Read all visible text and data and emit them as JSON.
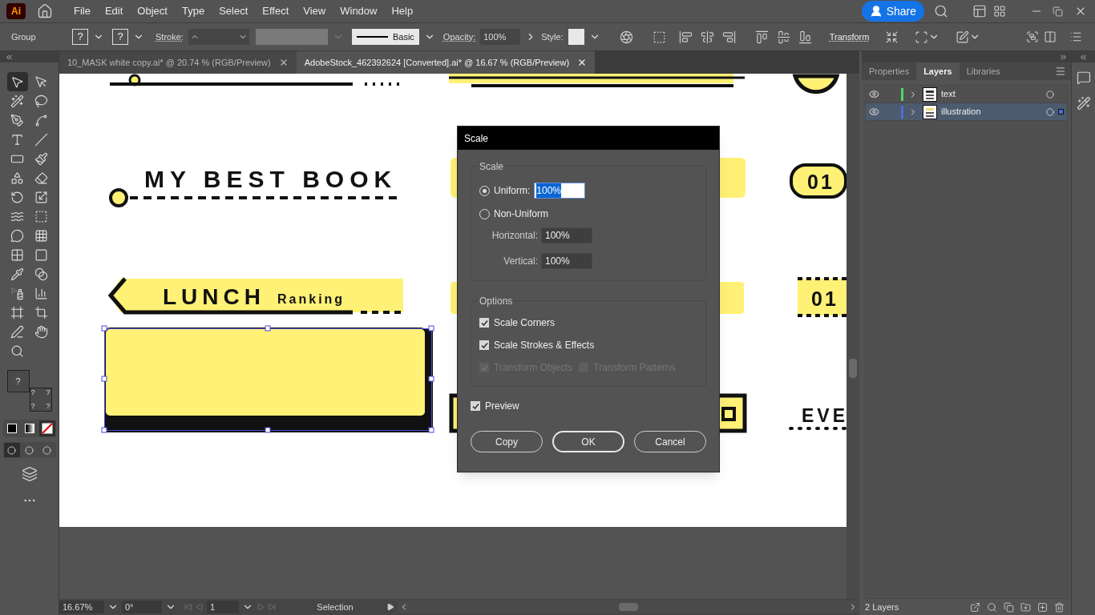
{
  "app_logo": "Ai",
  "menu": [
    "File",
    "Edit",
    "Object",
    "Type",
    "Select",
    "Effect",
    "View",
    "Window",
    "Help"
  ],
  "share_button": "Share",
  "control_bar": {
    "selection": "Group",
    "fill_label": "?",
    "stroke_swatch_label": "?",
    "stroke_label": "Stroke:",
    "brush": "Basic",
    "opacity_label": "Opacity:",
    "opacity": "100%",
    "style_label": "Style:",
    "transform": "Transform"
  },
  "tabs": [
    {
      "label": "10_MASK white copy.ai* @ 20.74 % (RGB/Preview)",
      "selected": false
    },
    {
      "label": "AdobeStock_462392624 [Converted].ai* @ 16.67 % (RGB/Preview)",
      "selected": true
    }
  ],
  "toolbar": {
    "tools": [
      {
        "selected": true
      },
      {
        "selected": false
      },
      {
        "selected": false
      },
      {
        "selected": false
      },
      {
        "selected": false
      },
      {
        "selected": false
      },
      {
        "selected": false
      },
      {
        "selected": false
      },
      {
        "selected": false
      },
      {
        "selected": false
      },
      {
        "selected": false
      },
      {
        "selected": false
      },
      {
        "selected": false
      },
      {
        "selected": false
      },
      {
        "selected": false
      },
      {
        "selected": false
      },
      {
        "selected": false
      },
      {
        "selected": false
      },
      {
        "selected": false
      },
      {
        "selected": false
      },
      {
        "selected": false
      },
      {
        "selected": false
      },
      {
        "selected": false
      },
      {
        "selected": false
      },
      {
        "selected": false
      },
      {
        "selected": false
      },
      {
        "selected": false
      },
      {
        "selected": false
      },
      {
        "selected": false
      }
    ],
    "fill_label": "?",
    "stroke_labels": [
      "?",
      "?",
      "?",
      "?"
    ],
    "color_modes": [
      {
        "selected": false
      },
      {
        "selected": false
      },
      {
        "selected": true
      }
    ],
    "draw_modes": [
      {
        "selected": true
      },
      {
        "selected": false
      },
      {
        "selected": false
      }
    ]
  },
  "artwork": {
    "heading": "MY BEST BOOK",
    "banner_title": "LUNCH",
    "banner_subtitle": "Ranking",
    "badges": [
      "01",
      "01"
    ],
    "partial_heading": "EVE"
  },
  "dialog": {
    "title": "Scale",
    "scale_section": "Scale",
    "uniform": {
      "label": "Uniform:",
      "selected": true,
      "value": "100%",
      "text_selected": true
    },
    "non_uniform": {
      "label": "Non-Uniform",
      "selected": false
    },
    "horizontal": {
      "label": "Horizontal:",
      "value": "100%"
    },
    "vertical": {
      "label": "Vertical:",
      "value": "100%"
    },
    "options_section": "Options",
    "options": [
      {
        "label": "Scale Corners",
        "checked": true,
        "disabled": false
      },
      {
        "label": "Scale Strokes & Effects",
        "checked": true,
        "disabled": false
      }
    ],
    "transform_options": [
      {
        "label": "Transform Objects",
        "checked": true,
        "disabled": true
      },
      {
        "label": "Transform Patterns",
        "checked": false,
        "disabled": true
      }
    ],
    "preview": {
      "label": "Preview",
      "checked": true
    },
    "buttons": [
      {
        "label": "Copy",
        "default": false
      },
      {
        "label": "OK",
        "default": true
      },
      {
        "label": "Cancel",
        "default": false
      }
    ]
  },
  "panel": {
    "tabs": [
      {
        "label": "Properties",
        "selected": false
      },
      {
        "label": "Layers",
        "selected": true
      },
      {
        "label": "Libraries",
        "selected": false
      }
    ],
    "layers": [
      {
        "name": "text",
        "color": "#4cd964",
        "visible": true,
        "selected": false
      },
      {
        "name": "illustration",
        "color": "#4a6fdc",
        "visible": true,
        "selected": true
      }
    ],
    "count": "2 Layers"
  },
  "status_bar": {
    "zoom": "16.67%",
    "rotation": "0°",
    "artboard": "1",
    "tool": "Selection"
  }
}
